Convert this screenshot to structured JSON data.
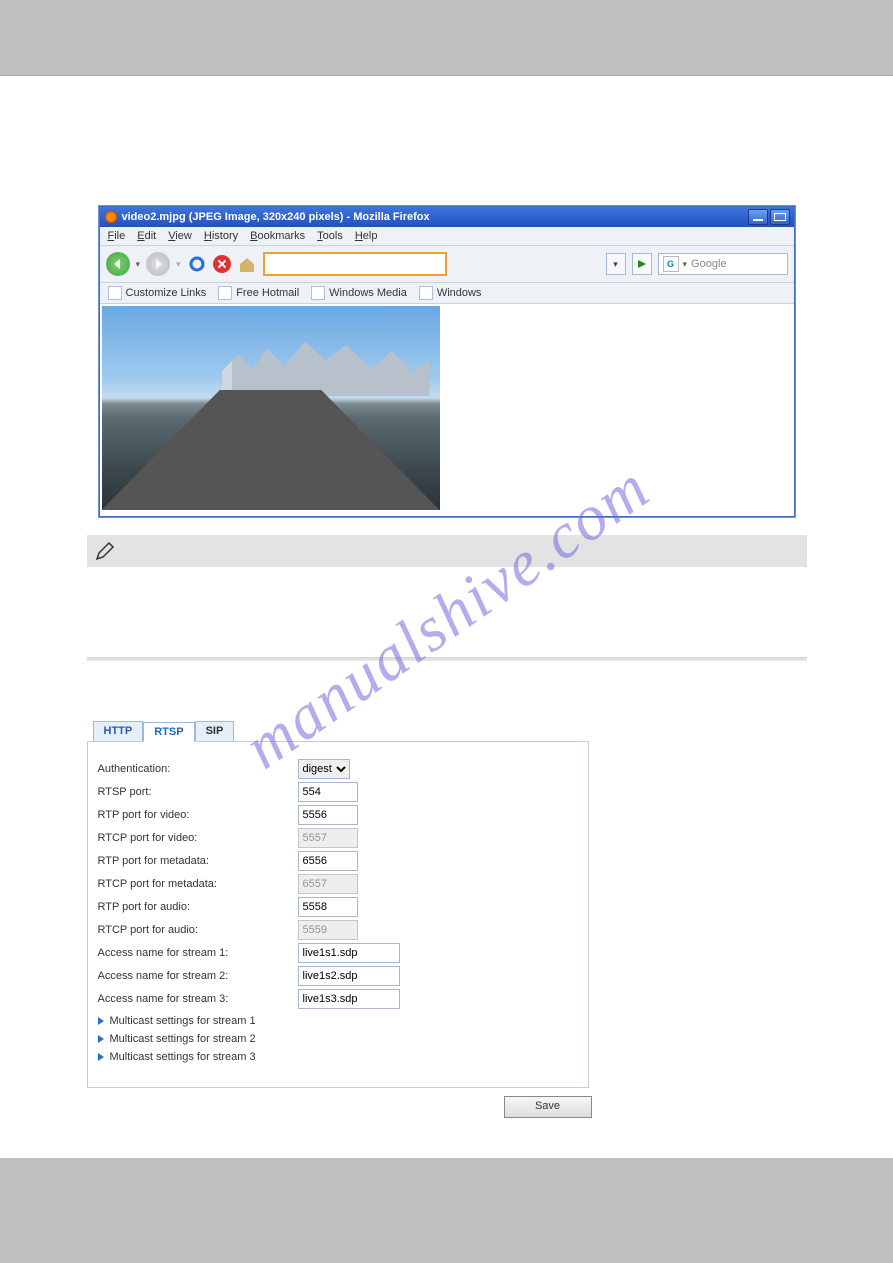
{
  "browser": {
    "title": "video2.mjpg (JPEG Image, 320x240 pixels) - Mozilla Firefox",
    "menu": {
      "file": "File",
      "edit": "Edit",
      "view": "View",
      "history": "History",
      "bookmarks": "Bookmarks",
      "tools": "Tools",
      "help": "Help"
    },
    "bookmarks_bar": {
      "customize": "Customize Links",
      "hotmail": "Free Hotmail",
      "winmedia": "Windows Media",
      "windows": "Windows"
    },
    "search_placeholder": "Google"
  },
  "watermark": "manualshive.com",
  "rtsp": {
    "tabs": {
      "http": "HTTP",
      "rtsp": "RTSP",
      "sip": "SIP"
    },
    "fields": {
      "auth_label": "Authentication:",
      "auth_value": "digest",
      "rtsp_port_label": "RTSP port:",
      "rtsp_port_value": "554",
      "rtp_video_label": "RTP port for video:",
      "rtp_video_value": "5556",
      "rtcp_video_label": "RTCP port for video:",
      "rtcp_video_value": "5557",
      "rtp_meta_label": "RTP port for metadata:",
      "rtp_meta_value": "6556",
      "rtcp_meta_label": "RTCP port for metadata:",
      "rtcp_meta_value": "6557",
      "rtp_audio_label": "RTP port for audio:",
      "rtp_audio_value": "5558",
      "rtcp_audio_label": "RTCP port for audio:",
      "rtcp_audio_value": "5559",
      "access1_label": "Access name for stream 1:",
      "access1_value": "live1s1.sdp",
      "access2_label": "Access name for stream 2:",
      "access2_value": "live1s2.sdp",
      "access3_label": "Access name for stream 3:",
      "access3_value": "live1s3.sdp"
    },
    "multicast": {
      "s1": "Multicast settings for stream 1",
      "s2": "Multicast settings for stream 2",
      "s3": "Multicast settings for stream 3"
    },
    "save": "Save"
  }
}
